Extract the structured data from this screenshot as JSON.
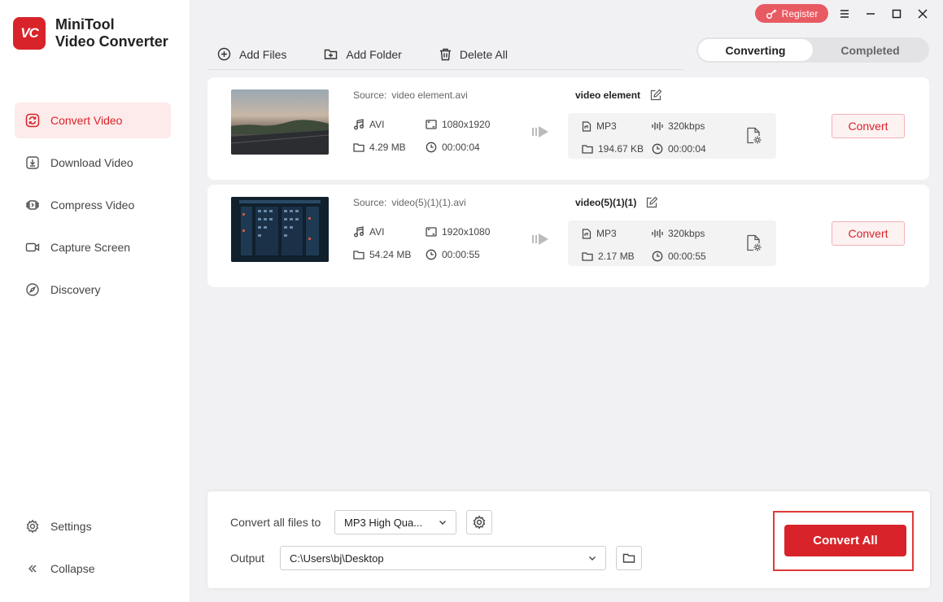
{
  "app": {
    "name_line1": "MiniTool",
    "name_line2": "Video Converter",
    "logo_text": "VC"
  },
  "sidebar": {
    "items": [
      {
        "label": "Convert Video",
        "icon": "convert-icon",
        "active": true
      },
      {
        "label": "Download Video",
        "icon": "download-icon"
      },
      {
        "label": "Compress Video",
        "icon": "compress-icon"
      },
      {
        "label": "Capture Screen",
        "icon": "camera-icon"
      },
      {
        "label": "Discovery",
        "icon": "compass-icon"
      }
    ],
    "bottom": [
      {
        "label": "Settings",
        "icon": "gear-icon"
      },
      {
        "label": "Collapse",
        "icon": "collapse-icon"
      }
    ]
  },
  "topbar": {
    "register_label": "Register"
  },
  "toolbar": {
    "add_files": "Add Files",
    "add_folder": "Add Folder",
    "delete_all": "Delete All"
  },
  "tabs": {
    "converting": "Converting",
    "completed": "Completed"
  },
  "files": [
    {
      "source_label": "Source:",
      "source_name": "video element.avi",
      "src_format": "AVI",
      "src_resolution": "1080x1920",
      "src_size": "4.29 MB",
      "src_duration": "00:00:04",
      "out_name": "video element",
      "out_format": "MP3",
      "out_bitrate": "320kbps",
      "out_size": "194.67 KB",
      "out_duration": "00:00:04",
      "convert_label": "Convert"
    },
    {
      "source_label": "Source:",
      "source_name": "video(5)(1)(1).avi",
      "src_format": "AVI",
      "src_resolution": "1920x1080",
      "src_size": "54.24 MB",
      "src_duration": "00:00:55",
      "out_name": "video(5)(1)(1)",
      "out_format": "MP3",
      "out_bitrate": "320kbps",
      "out_size": "2.17 MB",
      "out_duration": "00:00:55",
      "convert_label": "Convert"
    }
  ],
  "bottom": {
    "convert_all_to_label": "Convert all files to",
    "format_value": "MP3 High Qua...",
    "output_label": "Output",
    "output_path": "C:\\Users\\bj\\Desktop",
    "convert_all_label": "Convert All"
  },
  "colors": {
    "accent": "#d8232a",
    "register": "#e85a62"
  }
}
